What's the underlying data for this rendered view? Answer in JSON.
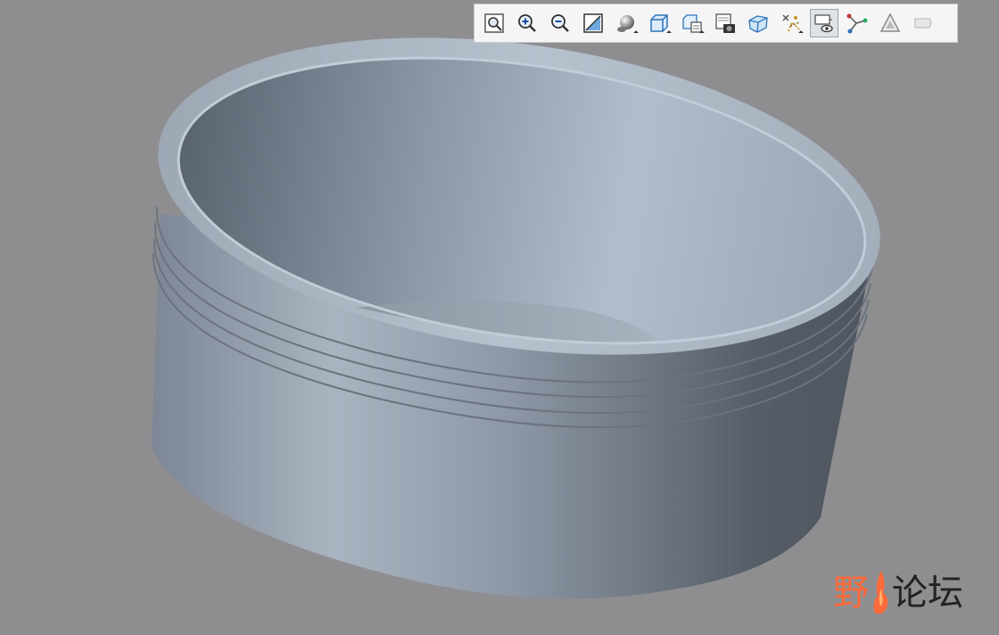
{
  "toolbar": {
    "buttons": [
      {
        "id": "refit",
        "icon": "refit-icon"
      },
      {
        "id": "zoom-in",
        "icon": "zoom-in-icon"
      },
      {
        "id": "zoom-out",
        "icon": "zoom-out-icon"
      },
      {
        "id": "repaint",
        "icon": "repaint-icon"
      },
      {
        "id": "display-style",
        "icon": "shaded-sphere-icon",
        "dropdown": true
      },
      {
        "id": "saved-views",
        "icon": "cube-view-icon",
        "dropdown": true
      },
      {
        "id": "named-views",
        "icon": "view-manager-icon",
        "dropdown": true
      },
      {
        "id": "snapshot",
        "icon": "camera-icon"
      },
      {
        "id": "perspective",
        "icon": "perspective-cube-icon"
      },
      {
        "id": "datum-display",
        "icon": "datum-display-icon",
        "dropdown": true
      },
      {
        "id": "annotation-display",
        "icon": "annotation-display-icon",
        "active": true
      },
      {
        "id": "spin-center",
        "icon": "spin-center-icon"
      },
      {
        "id": "appearance",
        "icon": "appearance-icon"
      },
      {
        "id": "last",
        "icon": "faded-tool-icon"
      }
    ]
  },
  "model": {
    "part": "threaded-cup",
    "colors": {
      "light": "#b3bfcc",
      "mid": "#97a3b1",
      "dark": "#555c66",
      "background": "#8e8e91"
    }
  },
  "watermark": {
    "part1": "野",
    "part2": "论坛",
    "accent": "#ff6a3a"
  }
}
